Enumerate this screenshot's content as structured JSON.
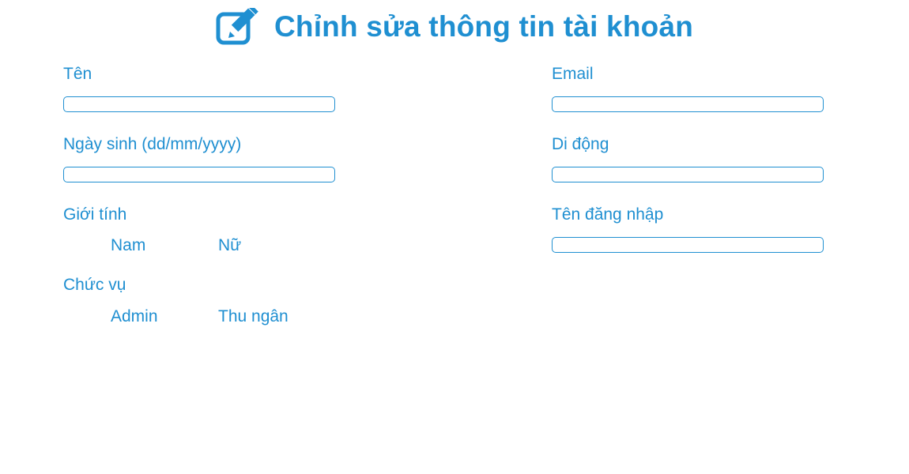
{
  "header": {
    "title": "Chỉnh sửa thông tin tài khoản",
    "icon": "edit-icon"
  },
  "theme": {
    "accent": "#1f8fd1",
    "background": "#ffffff"
  },
  "form": {
    "name": {
      "label": "Tên",
      "value": ""
    },
    "email": {
      "label": "Email",
      "value": ""
    },
    "birthday": {
      "label": "Ngày sinh (dd/mm/yyyy)",
      "value": ""
    },
    "mobile": {
      "label": "Di động",
      "value": ""
    },
    "gender": {
      "label": "Giới tính",
      "options": [
        "Nam",
        "Nữ"
      ]
    },
    "username": {
      "label": "Tên đăng nhập",
      "value": ""
    },
    "role": {
      "label": "Chức vụ",
      "options": [
        "Admin",
        "Thu ngân"
      ]
    }
  }
}
